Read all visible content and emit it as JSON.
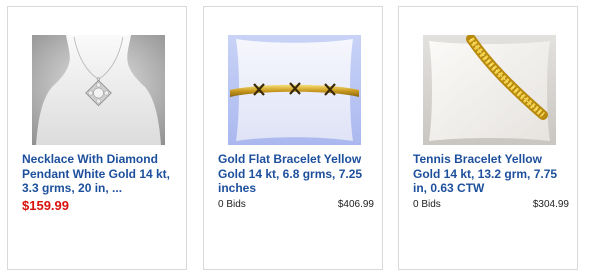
{
  "colors": {
    "title_link": "#1d4f9c",
    "price_highlight": "#d8110c",
    "card_border": "#d9d9d9"
  },
  "listings": [
    {
      "title": "Necklace With Diamond Pendant White Gold 14 kt, 3.3 grms, 20 in, ...",
      "price": "$159.99",
      "image_icon": "necklace-photo"
    },
    {
      "title": "Gold Flat Bracelet Yellow Gold 14 kt, 6.8 grms, 7.25 inches",
      "bids": "0 Bids",
      "price": "$406.99",
      "image_icon": "flat-bracelet-photo"
    },
    {
      "title": "Tennis Bracelet Yellow Gold 14 kt, 13.2 grm, 7.75 in, 0.63 CTW",
      "bids": "0 Bids",
      "price": "$304.99",
      "image_icon": "tennis-bracelet-photo"
    }
  ]
}
